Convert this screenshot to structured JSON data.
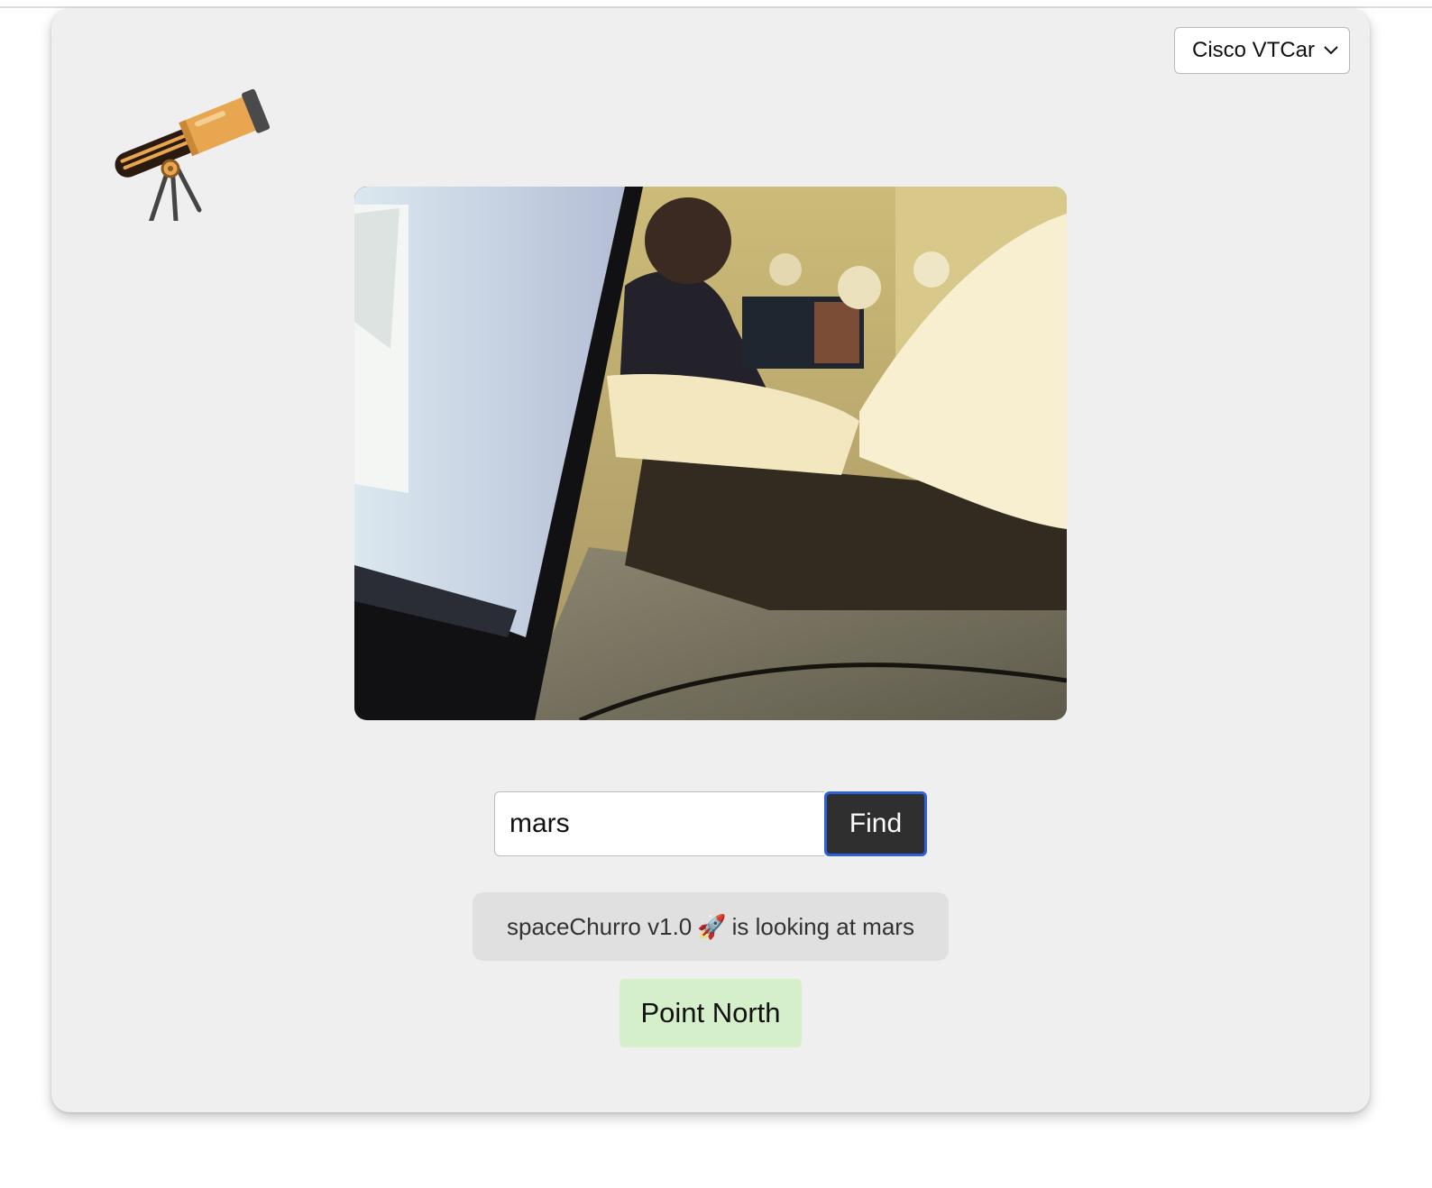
{
  "device_select": {
    "selected": "Cisco VTCar"
  },
  "logo": {
    "icon": "telescope-icon"
  },
  "camera": {
    "feed": "camera-feed-image"
  },
  "search": {
    "value": "mars",
    "button_label": "Find"
  },
  "status": {
    "prefix": "spaceChurro v1.0",
    "emoji": "🚀",
    "suffix": "is looking at mars"
  },
  "action": {
    "point_north_label": "Point North"
  },
  "colors": {
    "card_bg": "#efefef",
    "find_bg": "#2f2f2f",
    "find_border": "#2f62d6",
    "status_bg": "#e0e0e0",
    "point_north_bg": "#d6efcb"
  }
}
